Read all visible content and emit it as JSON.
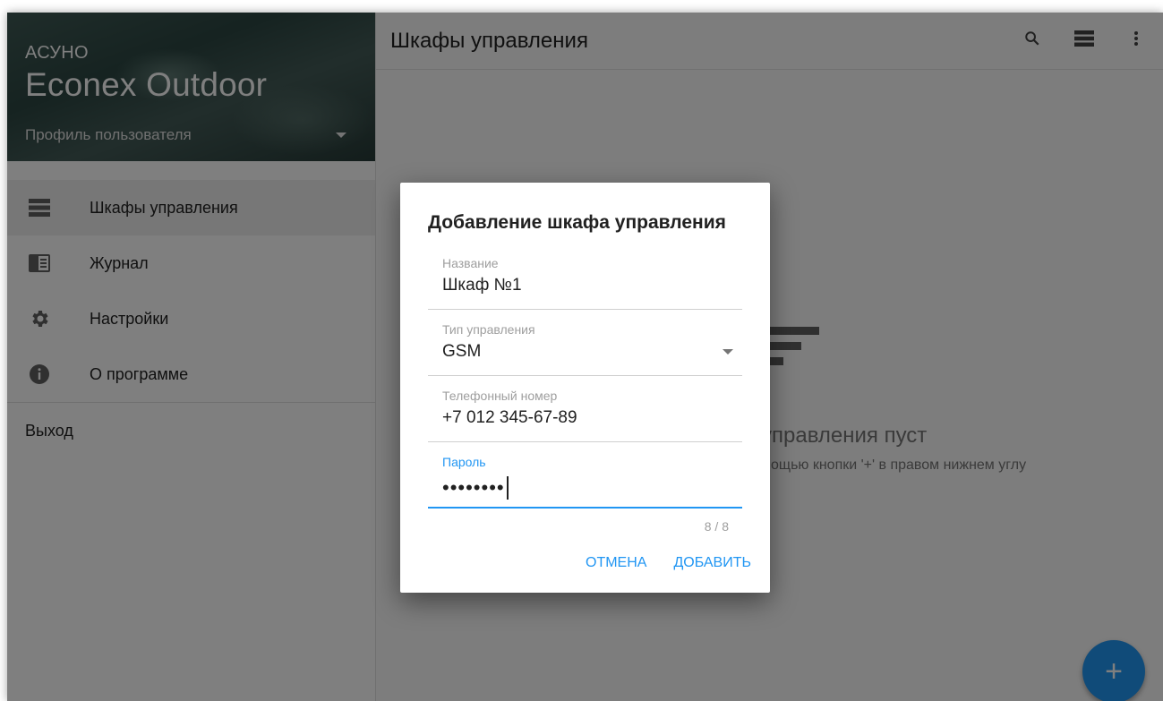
{
  "sidebar": {
    "subtitle": "АСУНО",
    "title": "Econex Outdoor",
    "profile_label": "Профиль пользователя",
    "items": [
      {
        "label": "Шкафы управления",
        "icon": "view-list-icon",
        "active": true
      },
      {
        "label": "Журнал",
        "icon": "book-icon",
        "active": false
      },
      {
        "label": "Настройки",
        "icon": "gear-icon",
        "active": false
      },
      {
        "label": "О программе",
        "icon": "info-icon",
        "active": false
      }
    ],
    "logout_label": "Выход"
  },
  "toolbar": {
    "title": "Шкафы управления",
    "icons": [
      "search-icon",
      "view-list-icon",
      "more-vert-icon"
    ]
  },
  "empty_state": {
    "title": "управления пуст",
    "subtitle": "мощью кнопки '+' в правом нижнем углу"
  },
  "fab": {
    "label": "+"
  },
  "dialog": {
    "title": "Добавление шкафа управления",
    "name": {
      "label": "Название",
      "value": "Шкаф №1"
    },
    "control_type": {
      "label": "Тип управления",
      "value": "GSM"
    },
    "phone": {
      "label": "Телефонный номер",
      "value": "+7 012 345-67-89"
    },
    "password": {
      "label": "Пароль",
      "value": "••••••••",
      "counter": "8 / 8"
    },
    "cancel_label": "ОТМЕНА",
    "add_label": "ДОБАВИТЬ"
  },
  "colors": {
    "accent": "#2196f3",
    "overlay": "rgba(0,0,0,0.5)"
  }
}
